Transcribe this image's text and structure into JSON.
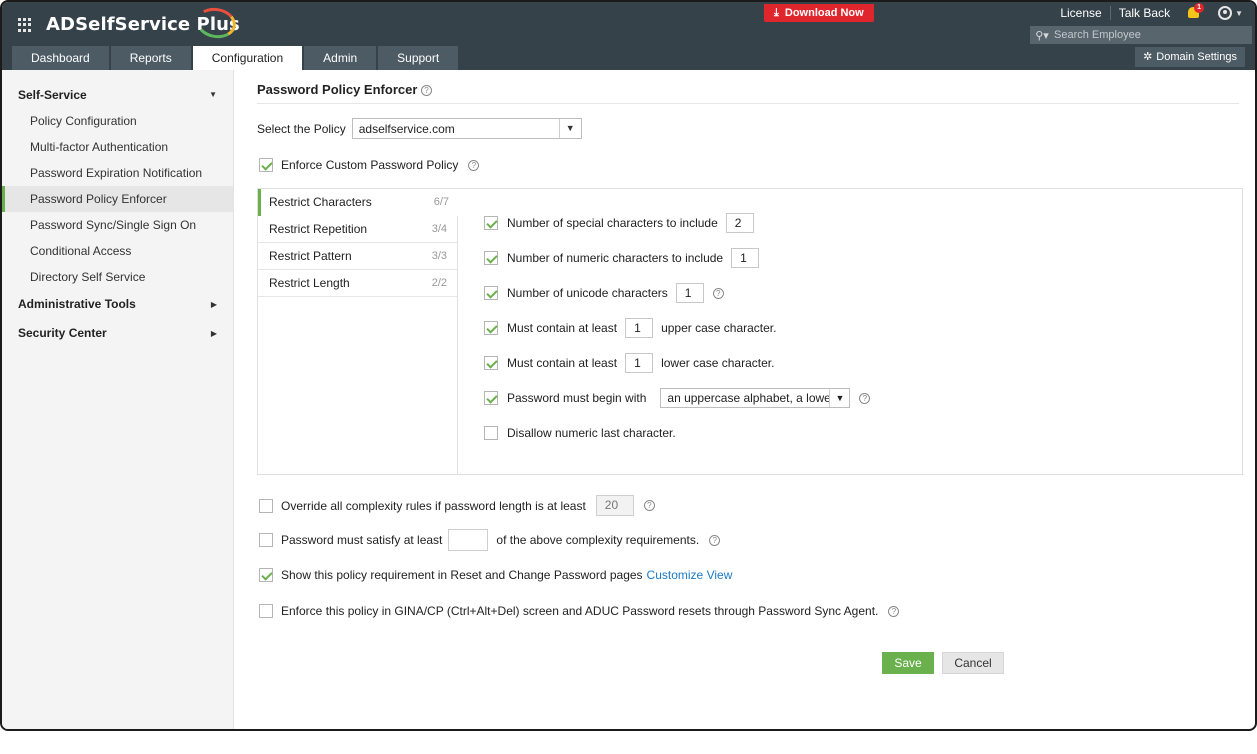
{
  "header": {
    "app_name": "ADSelfService Plus",
    "download_label": "Download Now",
    "links": [
      "License",
      "Talk Back"
    ],
    "notification_count": "1",
    "search_placeholder": "Search Employee",
    "domain_settings_label": "Domain Settings",
    "accent_download": "#e0262d",
    "icons": [
      "apps-grid-icon",
      "download-icon",
      "bell-icon",
      "user-icon",
      "search-icon",
      "gear-icon"
    ]
  },
  "tabs": [
    {
      "label": "Dashboard",
      "active": false
    },
    {
      "label": "Reports",
      "active": false
    },
    {
      "label": "Configuration",
      "active": true
    },
    {
      "label": "Admin",
      "active": false
    },
    {
      "label": "Support",
      "active": false
    }
  ],
  "sidebar": {
    "section_self_service": "Self-Service",
    "items": [
      {
        "label": "Policy Configuration",
        "active": false
      },
      {
        "label": "Multi-factor Authentication",
        "active": false
      },
      {
        "label": "Password Expiration Notification",
        "active": false
      },
      {
        "label": "Password Policy Enforcer",
        "active": true
      },
      {
        "label": "Password Sync/Single Sign On",
        "active": false
      },
      {
        "label": "Conditional Access",
        "active": false
      },
      {
        "label": "Directory Self Service",
        "active": false
      }
    ],
    "section_admin_tools": "Administrative Tools",
    "section_security": "Security Center"
  },
  "main": {
    "title": "Password Policy Enforcer",
    "select_policy_label": "Select the Policy",
    "selected_policy": "adselfservice.com",
    "enforce_custom_label": "Enforce Custom Password Policy",
    "enforce_custom_checked": true,
    "restriction_tabs": [
      {
        "label": "Restrict Characters",
        "count": "6/7",
        "active": true
      },
      {
        "label": "Restrict Repetition",
        "count": "3/4",
        "active": false
      },
      {
        "label": "Restrict Pattern",
        "count": "3/3",
        "active": false
      },
      {
        "label": "Restrict Length",
        "count": "2/2",
        "active": false
      }
    ],
    "options": {
      "special_label": "Number of special characters to include",
      "special_value": "2",
      "numeric_label": "Number of numeric characters to include",
      "numeric_value": "1",
      "unicode_label": "Number of unicode characters",
      "unicode_value": "1",
      "upper_prefix": "Must contain at least",
      "upper_value": "1",
      "upper_suffix": "upper case character.",
      "lower_prefix": "Must contain at least",
      "lower_value": "1",
      "lower_suffix": "lower case character.",
      "begin_label": "Password must begin with",
      "begin_value": "an uppercase alphabet, a lowe",
      "disallow_label": "Disallow numeric last character."
    },
    "override_label": "Override all complexity rules if password length is at least",
    "override_value": "20",
    "satisfy_prefix": "Password must satisfy at least",
    "satisfy_value": "",
    "satisfy_suffix": "of the above complexity requirements.",
    "show_policy_label": "Show this policy requirement in Reset and Change Password pages",
    "customize_view_link": "Customize View",
    "gina_label": "Enforce this policy in GINA/CP (Ctrl+Alt+Del) screen and ADUC Password resets through Password Sync Agent.",
    "save_label": "Save",
    "cancel_label": "Cancel",
    "accent_green": "#6ab04c"
  }
}
